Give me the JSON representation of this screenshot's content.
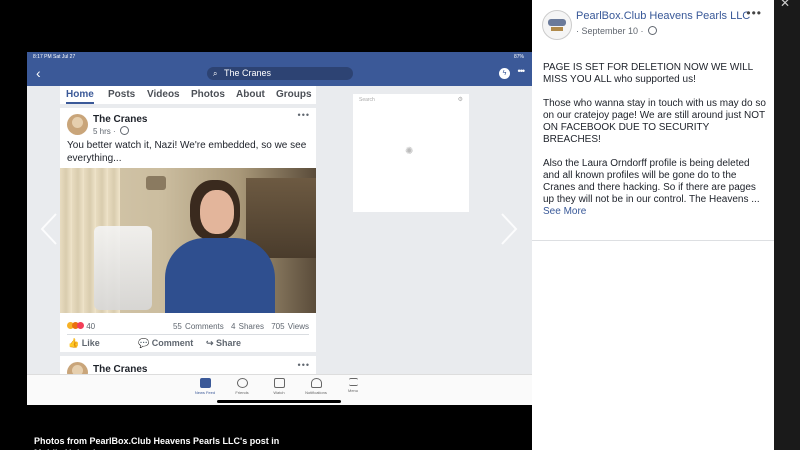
{
  "phone": {
    "status": {
      "time": "8:17 PM  Sat Jul 27",
      "right": "87%"
    },
    "search_text": "The Cranes",
    "tabs": [
      "Home",
      "Posts",
      "Videos",
      "Photos",
      "About",
      "Groups"
    ],
    "post": {
      "author": "The Cranes",
      "time": "5 hrs · ",
      "text": "You better watch it, Nazi! We're embedded, so we see everything...",
      "reactions_count": "40",
      "comments": "55 Comments",
      "shares": "4 Shares",
      "views": "705 Views",
      "like_label": "Like",
      "comment_label": "Comment",
      "share_label": "Share"
    },
    "post2_author": "The Cranes",
    "side_search_placeholder": "Search",
    "tabbar": [
      "News Feed",
      "Friends",
      "Watch",
      "Notifications",
      "Menu"
    ]
  },
  "caption": "Photos from PearlBox.Club Heavens Pearls LLC's post in Mobile Uploads",
  "panel": {
    "page_name": "PearlBox.Club Heavens Pearls LLC",
    "date": "· September 10 · ",
    "paragraphs": [
      "PAGE IS SET FOR DELETION NOW WE WILL MISS YOU ALL who supported us!",
      "Those who wanna stay in touch with us may do so on our cratejoy page! We are still around just NOT ON FACEBOOK DUE TO SECURITY BREACHES!",
      "Also the Laura Orndorff profile is being deleted and all known profiles will be gone do to the Cranes and there hacking. So if there are pages up they will not be in our control. The Heavens ..."
    ],
    "see_more": "See More"
  },
  "icons": [
    "back-arrow-icon",
    "search-icon",
    "messenger-icon",
    "more-icon",
    "globe-icon",
    "chevron-left-icon",
    "chevron-right-icon",
    "close-icon"
  ],
  "colors": {
    "facebook_blue": "#3b5998",
    "link": "#385898"
  }
}
